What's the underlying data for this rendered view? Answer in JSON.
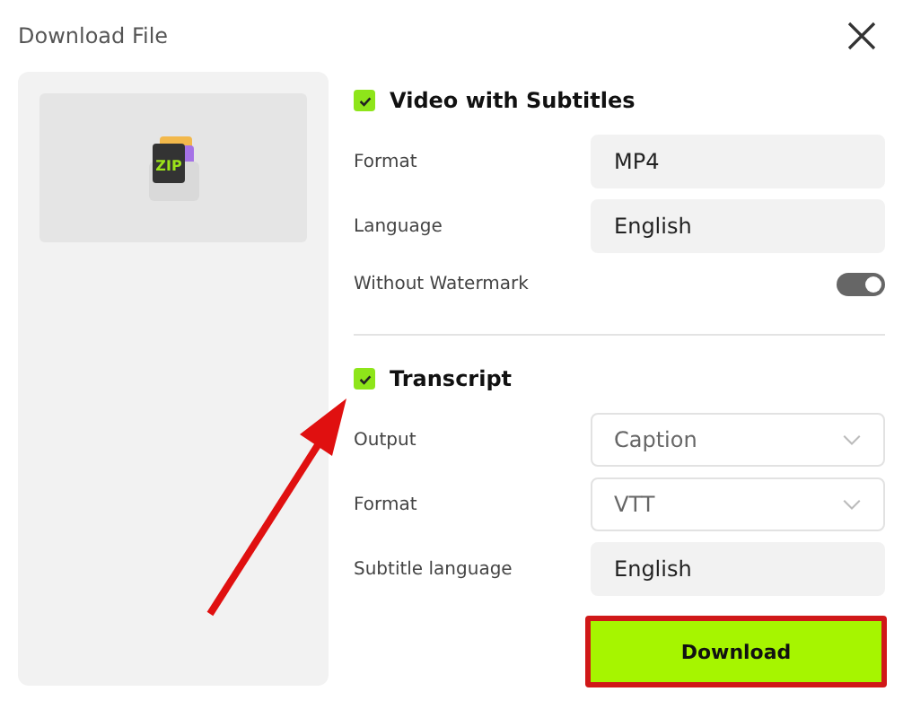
{
  "window": {
    "title": "Download File"
  },
  "preview": {
    "badge": "ZIP"
  },
  "sections": [
    {
      "label": "Video with Subtitles",
      "checked": true,
      "rows": [
        {
          "kind": "text",
          "label": "Format",
          "value": "MP4"
        },
        {
          "kind": "text",
          "label": "Language",
          "value": "English"
        },
        {
          "kind": "toggle",
          "label": "Without Watermark",
          "on": true
        }
      ]
    },
    {
      "label": "Transcript",
      "checked": true,
      "rows": [
        {
          "kind": "select",
          "label": "Output",
          "value": "Caption"
        },
        {
          "kind": "select",
          "label": "Format",
          "value": "VTT"
        },
        {
          "kind": "text",
          "label": "Subtitle language",
          "value": "English"
        }
      ]
    }
  ],
  "download_button": {
    "label": "Download",
    "highlighted": true
  },
  "annotation_arrow": {
    "shown": true
  }
}
